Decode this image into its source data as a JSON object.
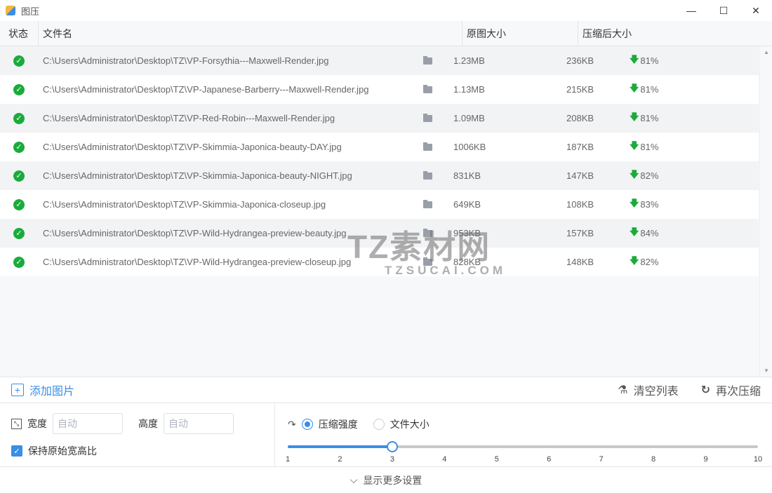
{
  "window": {
    "title": "图压",
    "minimize": "—",
    "maximize": "☐",
    "close": "✕"
  },
  "columns": {
    "status": "状态",
    "filename": "文件名",
    "original": "原图大小",
    "compressed": "压缩后大小"
  },
  "rows": [
    {
      "file": "C:\\Users\\Administrator\\Desktop\\TZ\\VP-Forsythia---Maxwell-Render.jpg",
      "original": "1.23MB",
      "compressed": "236KB",
      "ratio": "81%"
    },
    {
      "file": "C:\\Users\\Administrator\\Desktop\\TZ\\VP-Japanese-Barberry---Maxwell-Render.jpg",
      "original": "1.13MB",
      "compressed": "215KB",
      "ratio": "81%"
    },
    {
      "file": "C:\\Users\\Administrator\\Desktop\\TZ\\VP-Red-Robin---Maxwell-Render.jpg",
      "original": "1.09MB",
      "compressed": "208KB",
      "ratio": "81%"
    },
    {
      "file": "C:\\Users\\Administrator\\Desktop\\TZ\\VP-Skimmia-Japonica-beauty-DAY.jpg",
      "original": "1006KB",
      "compressed": "187KB",
      "ratio": "81%"
    },
    {
      "file": "C:\\Users\\Administrator\\Desktop\\TZ\\VP-Skimmia-Japonica-beauty-NIGHT.jpg",
      "original": "831KB",
      "compressed": "147KB",
      "ratio": "82%"
    },
    {
      "file": "C:\\Users\\Administrator\\Desktop\\TZ\\VP-Skimmia-Japonica-closeup.jpg",
      "original": "649KB",
      "compressed": "108KB",
      "ratio": "83%"
    },
    {
      "file": "C:\\Users\\Administrator\\Desktop\\TZ\\VP-Wild-Hydrangea-preview-beauty.jpg",
      "original": "953KB",
      "compressed": "157KB",
      "ratio": "84%"
    },
    {
      "file": "C:\\Users\\Administrator\\Desktop\\TZ\\VP-Wild-Hydrangea-preview-closeup.jpg",
      "original": "828KB",
      "compressed": "148KB",
      "ratio": "82%"
    }
  ],
  "watermark": {
    "name": "TZ素材网",
    "url": "TZSUCAI.COM"
  },
  "toolbar": {
    "add": "添加图片",
    "clear": "清空列表",
    "recompress": "再次压缩"
  },
  "resize": {
    "width_label": "宽度",
    "width_placeholder": "自动",
    "height_label": "高度",
    "height_placeholder": "自动",
    "keep_ratio": "保持原始宽高比",
    "keep_ratio_checked": true
  },
  "compress": {
    "mode_strength": "压缩强度",
    "mode_size": "文件大小",
    "selected_mode": "strength",
    "level": 3,
    "min": 1,
    "max": 10,
    "ticks": [
      "1",
      "2",
      "3",
      "4",
      "5",
      "6",
      "7",
      "8",
      "9",
      "10"
    ]
  },
  "footer": {
    "more": "显示更多设置"
  },
  "colors": {
    "accent": "#3a8ee6",
    "success": "#1aab3c"
  }
}
